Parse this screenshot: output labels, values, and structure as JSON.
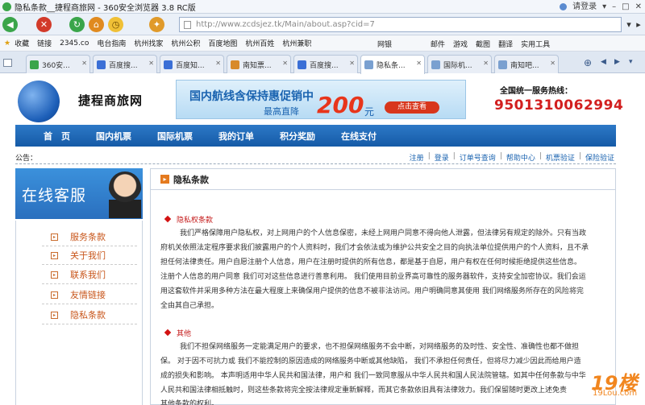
{
  "browser": {
    "title": "隐私条款__捷程商旅网 - 360安全浏览器 3.8 RC版",
    "login": "请登录",
    "url": "http://www.zcdsjez.tk/Main/about.asp?cid=7",
    "favorites_label": "收藏",
    "favorites": [
      "链接",
      "2345.co",
      "电台指南",
      "杭州找家",
      "杭州公积",
      "百度地图",
      "杭州百姓",
      "杭州兼职"
    ],
    "fav_right": [
      "网银",
      "邮件",
      "游戏",
      "截图",
      "翻译",
      "实用工具"
    ],
    "tabs": [
      "360安...",
      "百度搜...",
      "百度知...",
      "南知票...",
      "百度搜...",
      "隐私条...",
      "国际机...",
      "南知吧..."
    ],
    "active_tab_index": 5
  },
  "site": {
    "name": "捷程商旅网",
    "banner": {
      "line1": "国内航线含保持惠促销中",
      "line2": "最高直降",
      "amount": "200",
      "unit": "元",
      "cta": "点击查看"
    },
    "hotline_label": "全国统一服务热线：",
    "hotline_number": "9501310062994",
    "nav": [
      "首　页",
      "国内机票",
      "国际机票",
      "我的订单",
      "积分奖励",
      "在线支付"
    ],
    "notice_label": "公告：",
    "top_links": [
      "注册",
      "登录",
      "订单号查询",
      "帮助中心",
      "机票验证",
      "保险验证"
    ],
    "service_title": "在线客服",
    "side_menu": [
      "服务条款",
      "关于我们",
      "联系我们",
      "友情链接",
      "隐私条款"
    ],
    "content_title": "隐私条款",
    "sections": [
      {
        "heading": "隐私权条款",
        "lines": [
          "我们严格保障用户隐私权，对上网用户的个人信息保密，未经上网用户同意不得向他人泄露，但法律另有规定的除外。只有当政",
          "府机关依照法定程序要求我们披露用户的个人资料时，我们才会依法或为维护公共安全之目的向执法单位提供用户的个人资料，且不承",
          "担任何法律责任。用户自愿注册个人信息，用户在注册时提供的所有信息，都是基于自愿，用户有权在任何时候拒绝提供这些信息。",
          "注册个人信息的用户同意 我们可对这些信息进行善意利用。 我们使用目前业界高可靠性的服务器软件，支持安全加密协议。我们会运",
          "用这套软件并采用多种方法在最大程度上来确保用户提供的信息不被非法访问。用户明确同意其使用 我们网络服务所存在的风险将完",
          "全由其自己承担。"
        ]
      },
      {
        "heading": "其他",
        "lines": [
          "我们不担保网络服务一定能满足用户的要求，也不担保网络服务不会中断，对网络服务的及时性、安全性、准确性也都不做担",
          "保。 对于因不可抗力或 我们不能控制的原因造成的网络服务中断或其他缺陷， 我们不承担任何责任，但将尽力减少因此而给用户造",
          "成的损失和影响。 本声明适用中华人民共和国法律，用户和 我们一致同意服从中华人民共和国人民法院管辖。如其中任何条款与中华",
          "人民共和国法律相抵触时，则这些条款将完全按法律规定重新解释，而其它条款依旧具有法律效力。我们保留随时更改上述免责",
          "其他条款的权利。"
        ]
      }
    ]
  },
  "watermark": {
    "main": "19楼",
    "sub": "19Lou.com"
  },
  "colors": {
    "nav_blue": "#1a63b0",
    "hotline_red": "#d21f1f",
    "side_orange": "#c8551a",
    "section_red": "#c41a1a"
  }
}
